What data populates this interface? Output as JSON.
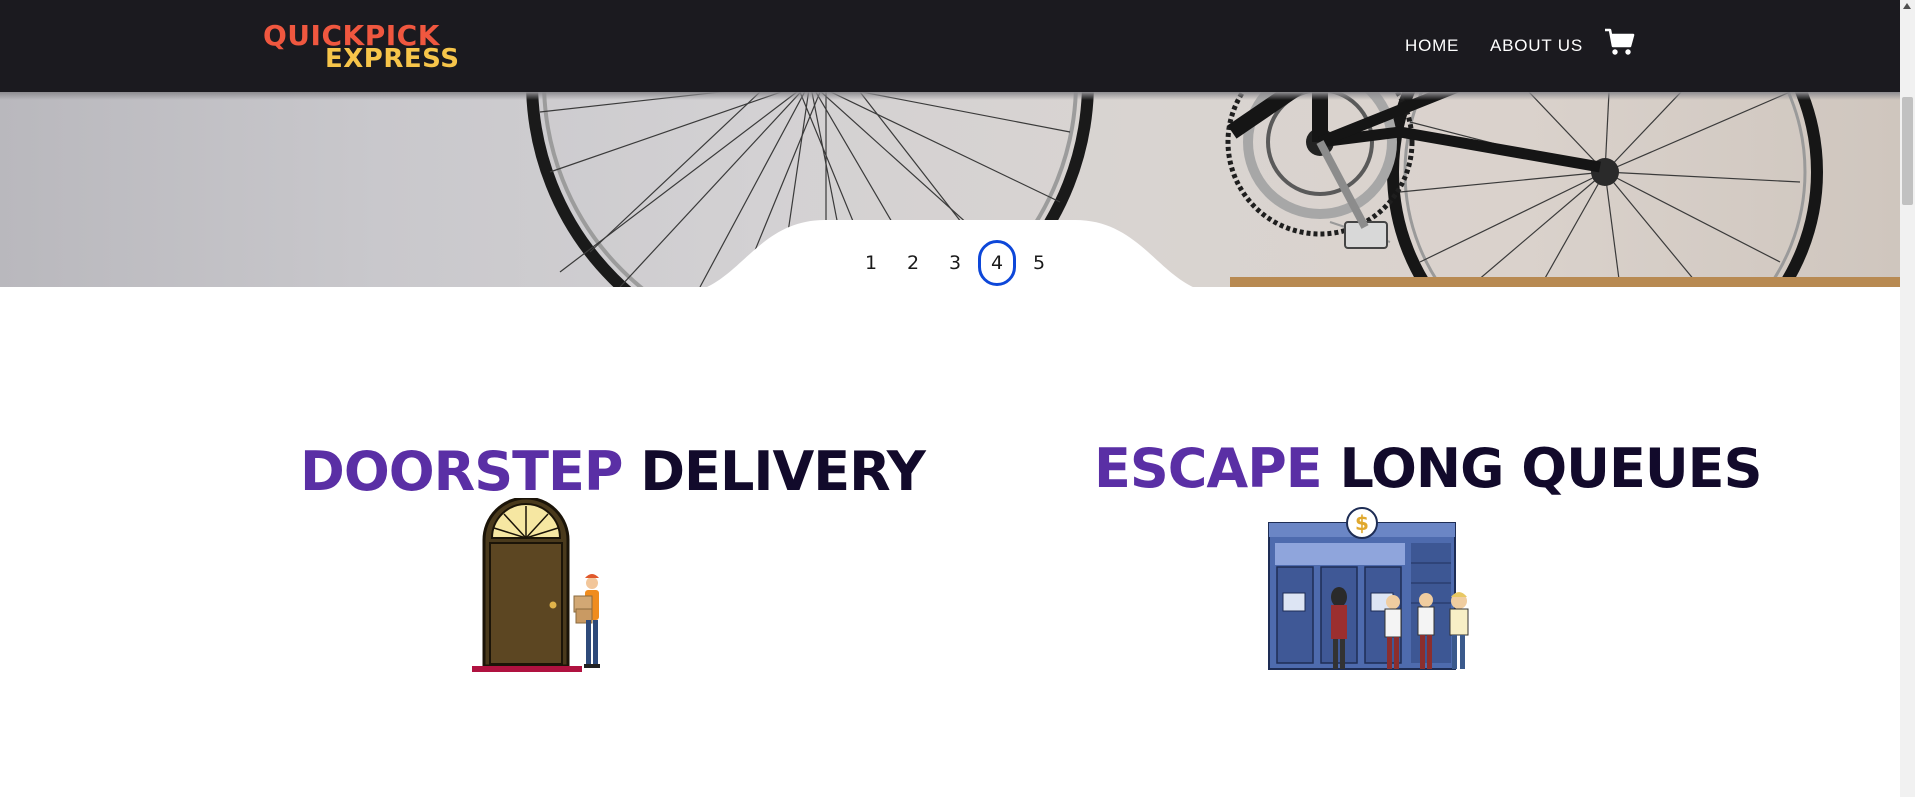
{
  "header": {
    "logo": {
      "line1": "QUICKPICK",
      "line2": "EXPRESS"
    },
    "nav": {
      "home": "HOME",
      "about": "ABOUT US"
    },
    "cart_icon": "cart-icon"
  },
  "hero": {
    "pagination": [
      {
        "label": "1",
        "active": false
      },
      {
        "label": "2",
        "active": false
      },
      {
        "label": "3",
        "active": false
      },
      {
        "label": "4",
        "active": true
      },
      {
        "label": "5",
        "active": false
      }
    ]
  },
  "features": [
    {
      "accent": "DOORSTEP",
      "rest": "DELIVERY",
      "icon": "door-delivery-illustration"
    },
    {
      "accent": "ESCAPE",
      "rest": "LONG QUEUES",
      "icon": "atm-queue-illustration"
    }
  ],
  "colors": {
    "nav_bg": "#1b1a1f",
    "accent_purple": "#5a2fa5",
    "title_dark": "#120a2b",
    "active_page_border": "#0d47d9",
    "logo_red": "#f0573f",
    "logo_yellow": "#f7c54a"
  }
}
